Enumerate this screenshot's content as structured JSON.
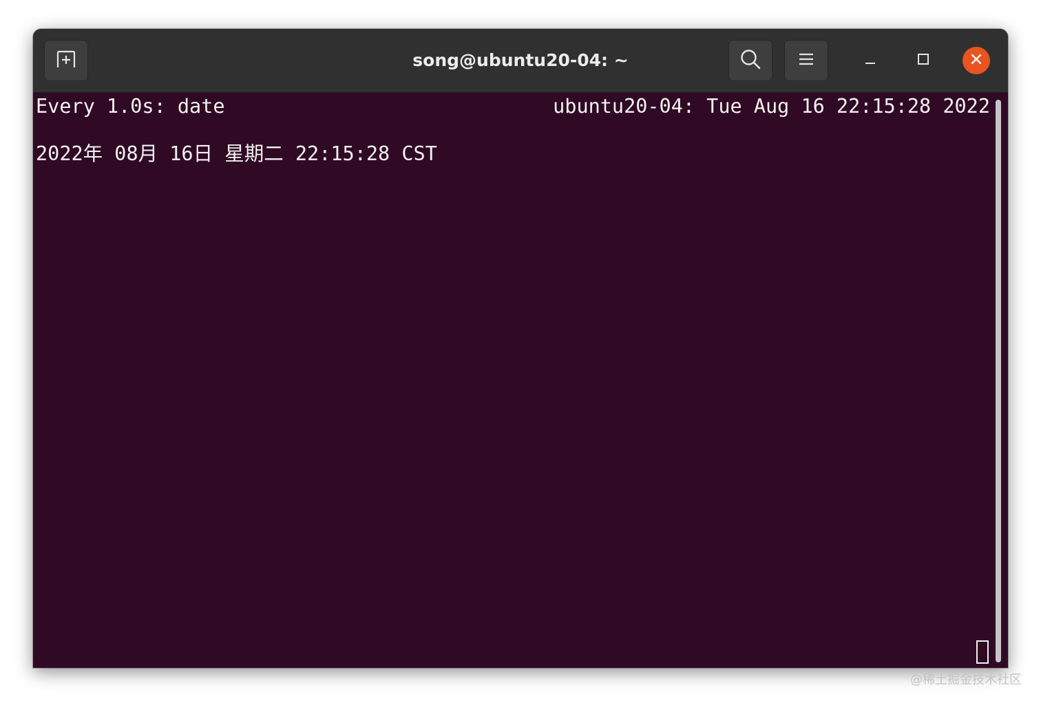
{
  "window": {
    "title": "song@ubuntu20-04: ~",
    "accent_close": "#e95420",
    "background": "#300a24"
  },
  "headerbar": {
    "new_tab_icon": "new-tab-icon",
    "search_icon": "search-icon",
    "menu_icon": "hamburger-menu-icon",
    "minimize_icon": "minimize-icon",
    "maximize_icon": "maximize-icon",
    "close_icon": "close-icon"
  },
  "terminal": {
    "header_left": "Every 1.0s: date",
    "header_right": "ubuntu20-04: Tue Aug 16 22:15:28 2022",
    "output_line": "2022年 08月 16日 星期二 22:15:28 CST"
  },
  "watermark": "@稀土掘金技术社区"
}
